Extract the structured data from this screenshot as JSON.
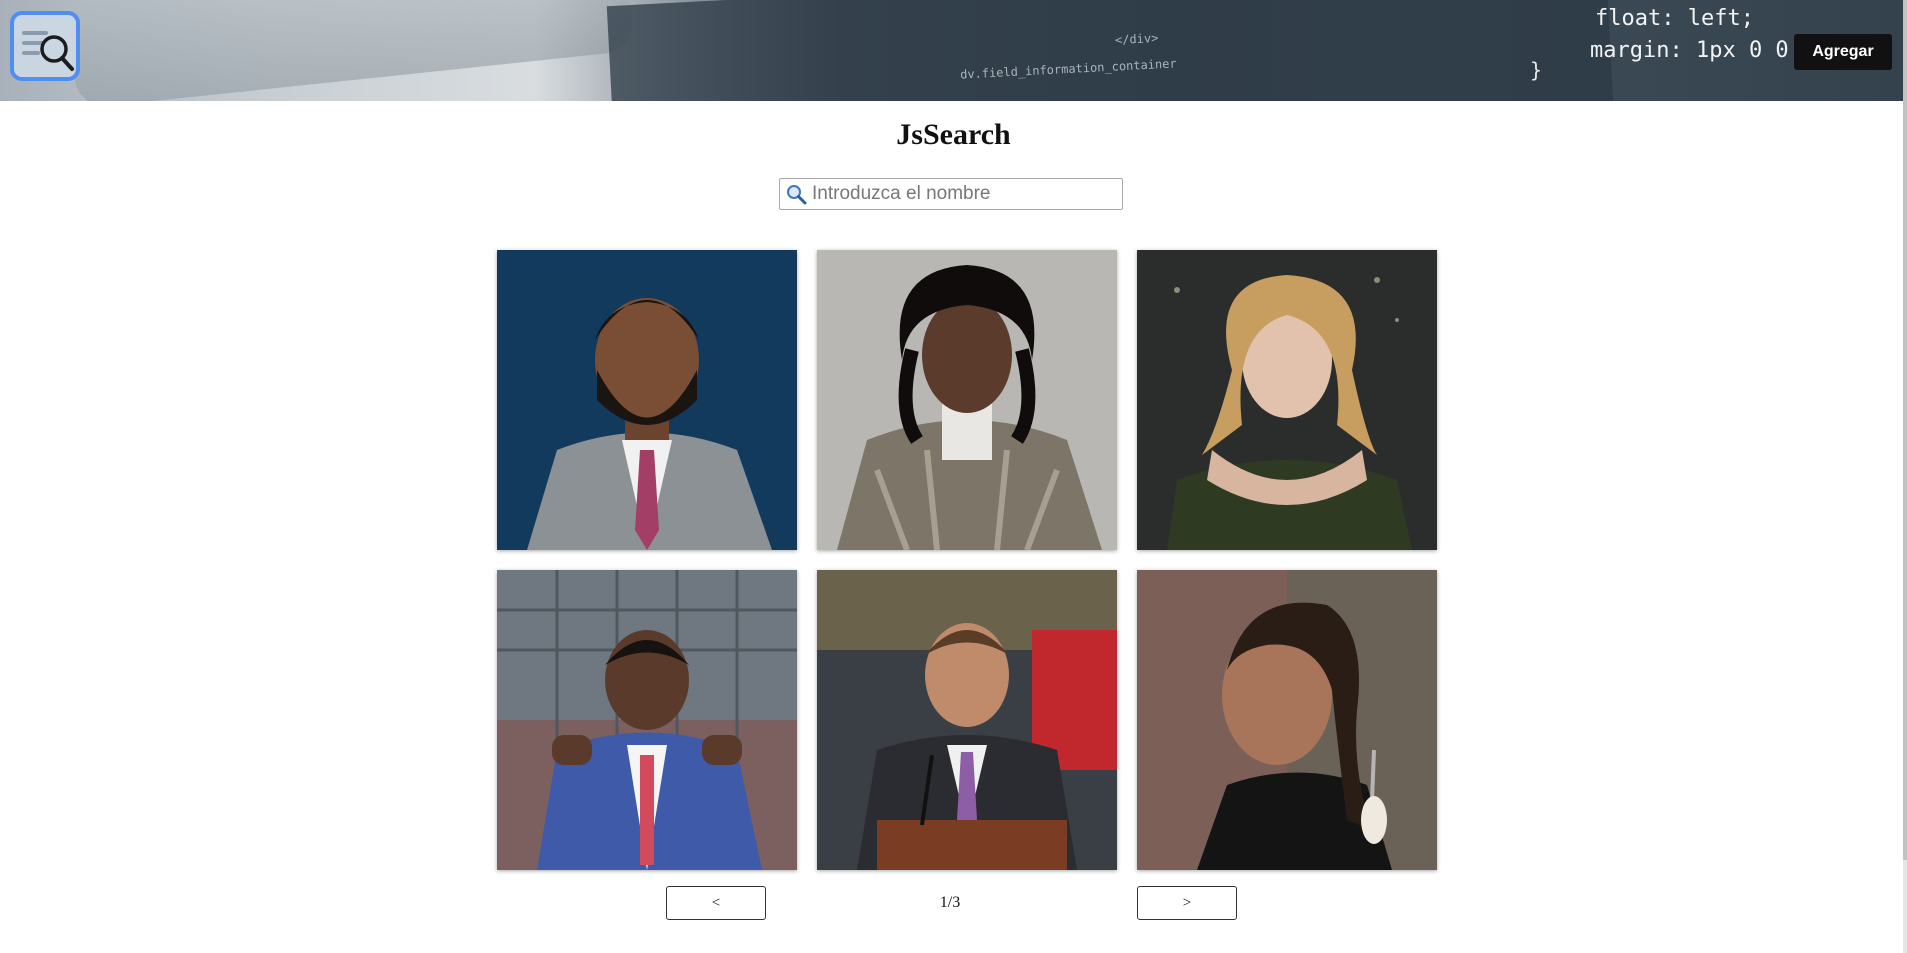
{
  "header": {
    "code_line_1": "float: left;",
    "code_line_2": "margin: 1px 0 0 5px;",
    "code_line_3": "}",
    "code_small_1": "dv.field_information_container",
    "code_small_2": "</div>",
    "logo_icon": "search-list-icon",
    "add_button_label": "Agregar"
  },
  "main": {
    "title": "JsSearch",
    "search": {
      "placeholder": "Introduzca el nombre",
      "value": "",
      "icon": "magnifier-icon"
    }
  },
  "gallery": {
    "items": [
      {
        "photo": "portrait-man-gray-suit-pink-tie",
        "background": "#123a5c"
      },
      {
        "photo": "portrait-man-sequined-jacket",
        "background": "#b9b7b4"
      },
      {
        "photo": "portrait-woman-blonde-green-dress",
        "background": "#2a2d2c"
      },
      {
        "photo": "portrait-man-blue-suit-stadium",
        "background": "#6f7780"
      },
      {
        "photo": "portrait-man-podium-purple-tie",
        "background": "#3a3f45"
      },
      {
        "photo": "portrait-woman-braid-pearl-earrings",
        "background": "#6b6257"
      }
    ]
  },
  "pagination": {
    "prev_label": "<",
    "next_label": ">",
    "indicator": "1/3"
  }
}
